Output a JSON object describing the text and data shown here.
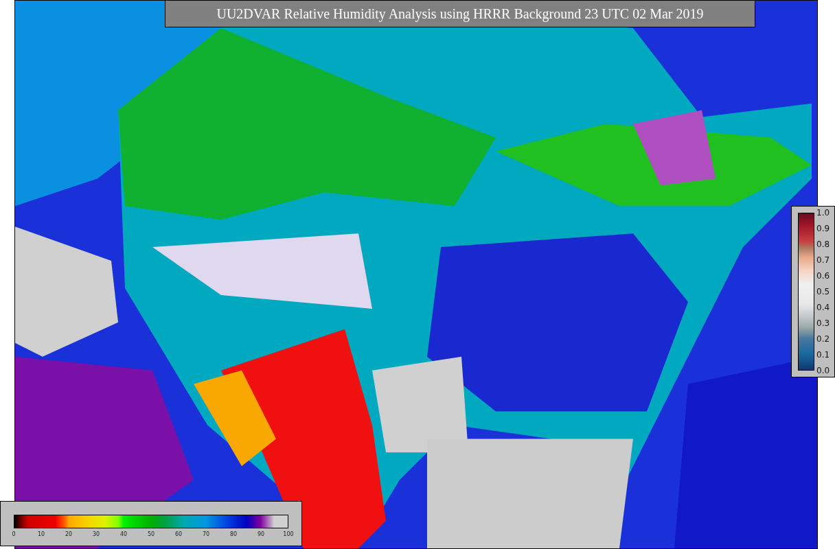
{
  "title": "UU2DVAR Relative Humidity Analysis using HRRR Background 23 UTC 02 Mar 2019",
  "main_colorbar": {
    "labels": [
      "0",
      "10",
      "20",
      "30",
      "40",
      "50",
      "60",
      "70",
      "80",
      "90",
      "100"
    ]
  },
  "side_colorbar": {
    "labels": [
      "1.0",
      "0.9",
      "0.8",
      "0.7",
      "0.6",
      "0.5",
      "0.4",
      "0.3",
      "0.2",
      "0.1",
      "0.0"
    ]
  }
}
